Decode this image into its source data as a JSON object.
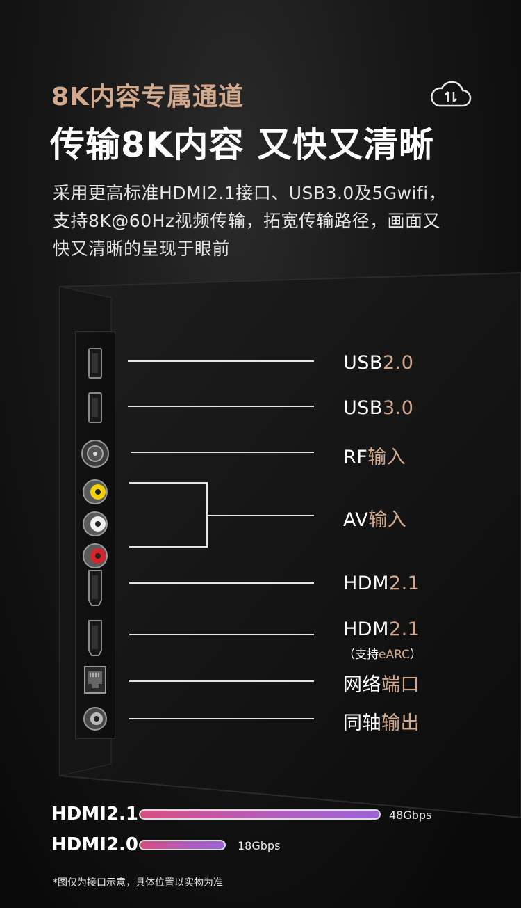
{
  "header": {
    "eyebrow": "8K内容专属通道",
    "headline": "传输8K内容 又快又清晰",
    "description": "采用更高标准HDMI2.1接口、USB3.0及5Gwifi，支持8K@60Hz视频传输，拓宽传输路径，画面又快又清晰的呈现于眼前"
  },
  "ports": [
    {
      "lead": "USB",
      "rest": "2.0"
    },
    {
      "lead": "USB",
      "rest": "3.0"
    },
    {
      "lead": "RF",
      "rest": "输入"
    },
    {
      "lead": "AV",
      "rest": "输入"
    },
    {
      "lead": "HDM",
      "rest": "2.1"
    },
    {
      "lead": "HDM",
      "rest": "2.1"
    },
    {
      "lead": "网络",
      "rest": "端口"
    },
    {
      "lead": "同轴",
      "rest": "输出"
    }
  ],
  "earc_note": {
    "open": "（支持",
    "accent": "eARC",
    "close": "）"
  },
  "speed_bars": [
    {
      "name": "HDMI2.1",
      "value_text": "48Gbps",
      "gbps": 48
    },
    {
      "name": "HDMI2.0",
      "value_text": "18Gbps",
      "gbps": 18
    }
  ],
  "footnote": "*图仅为接口示意，具体位置以实物为准",
  "colors": {
    "accent_gold": "#d3a98d",
    "bar_gradient_start": "#d94d83",
    "bar_gradient_end": "#9a63d6",
    "av_yellow": "#f2d00a",
    "av_white": "#f0f0f0",
    "av_red": "#d8232a"
  },
  "icons": {
    "top_right": "cloud-transfer-icon"
  }
}
